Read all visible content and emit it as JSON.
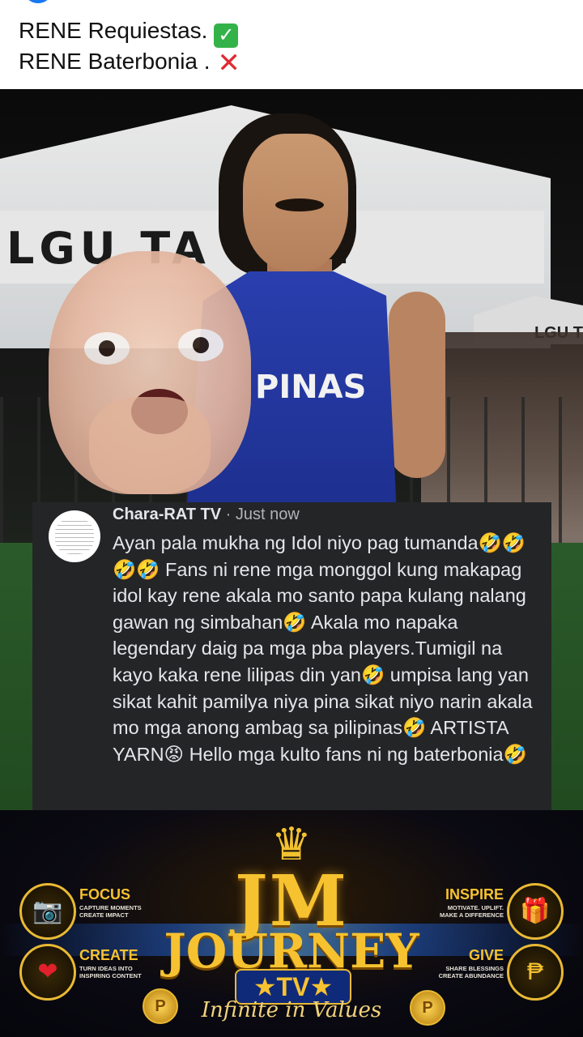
{
  "caption": {
    "line1_text": "RENE Requiestas.",
    "line1_mark": "✓",
    "line2_text": "RENE Baterbonia .",
    "line2_mark": "✕"
  },
  "photo": {
    "tent_sign": "LGU TA   GON",
    "tent_sign_small": "LGU T",
    "jersey_text": "PINAS"
  },
  "comment": {
    "author": "Chara-RAT TV",
    "separator": " · ",
    "time": "Just now",
    "body": "Ayan pala mukha ng Idol niyo pag tumanda🤣🤣🤣🤣 Fans ni rene mga monggol kung makapag idol kay rene akala mo santo papa kulang nalang gawan ng simbahan🤣 Akala mo napaka legendary daig pa mga pba players.Tumigil na kayo kaka rene lilipas din yan🤣 umpisa lang yan sikat kahit pamilya niya pina sikat niyo narin akala mo mga anong ambag sa pilipinas🤣 ARTISTA YARN😡 Hello mga kulto fans ni ng baterbonia🤣"
  },
  "banner": {
    "crown_icon": "♛",
    "title_jm": "JM",
    "title_journey": "JOURNEY",
    "title_tv": "★TV★",
    "tagline": "Infinite in Values",
    "badges": [
      {
        "label": "FOCUS",
        "sub": "CAPTURE MOMENTS CREATE IMPACT",
        "icon": "📷"
      },
      {
        "label": "CREATE",
        "sub": "TURN IDEAS INTO INSPIRING CONTENT",
        "icon": "❤"
      },
      {
        "label": "INSPIRE",
        "sub": "MOTIVATE. UPLIFT. MAKE A DIFFERENCE",
        "icon": "🎁"
      },
      {
        "label": "GIVE",
        "sub": "SHARE BLESSINGS CREATE ABUNDANCE",
        "icon": "₱"
      }
    ],
    "coin_symbol": "P"
  }
}
